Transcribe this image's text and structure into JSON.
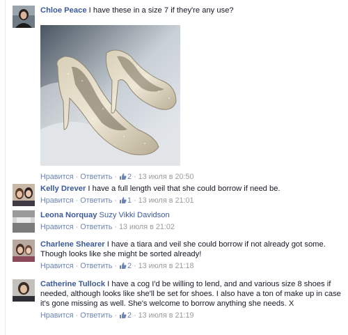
{
  "comments": [
    {
      "author": "Chloe Peace",
      "text": "I have these in a size 7 if they're any use?",
      "like_label": "Нравится",
      "reply_label": "Ответить",
      "likes": "2",
      "time": "13 июля в 20:50",
      "avatar_icon": "profile-photo"
    },
    {
      "author": "Kelly Drever",
      "text": "I have a full length veil that she could borrow if need be.",
      "like_label": "Нравится",
      "reply_label": "Ответить",
      "likes": "1",
      "time": "13 июля в 21:01",
      "avatar_icon": "profile-photo"
    },
    {
      "author": "Leona Norquay",
      "mention": "Suzy Vikki Davidson",
      "like_label": "Нравится",
      "reply_label": "Ответить",
      "time": "13 июля в 21:02",
      "avatar_icon": "profile-photo"
    },
    {
      "author": "Charlene Shearer",
      "text": "I have a tiara and veil she could borrow if not already got some. Though looks like she might be sorted already!",
      "like_label": "Нравится",
      "reply_label": "Ответить",
      "likes": "2",
      "time": "13 июля в 21:18",
      "avatar_icon": "profile-photo"
    },
    {
      "author": "Catherine Tullock",
      "text": "I have a cog I'd be willing to lend, and and various size 8 shoes if needed, although looks like she'll be set for shoes. I also have a ton of make up in case it's gone missing as well. She's welcome to borrow anything she needs. X",
      "like_label": "Нравится",
      "reply_label": "Ответить",
      "likes": "2",
      "time": "13 июля в 21:19",
      "avatar_icon": "profile-photo"
    }
  ],
  "colors": {
    "author_link": "#3b5998",
    "action_link": "#6d84b4",
    "meta_text": "#999999"
  },
  "icons": {
    "like": "thumbs-up-icon",
    "photo": "glitter-heels-photo"
  }
}
